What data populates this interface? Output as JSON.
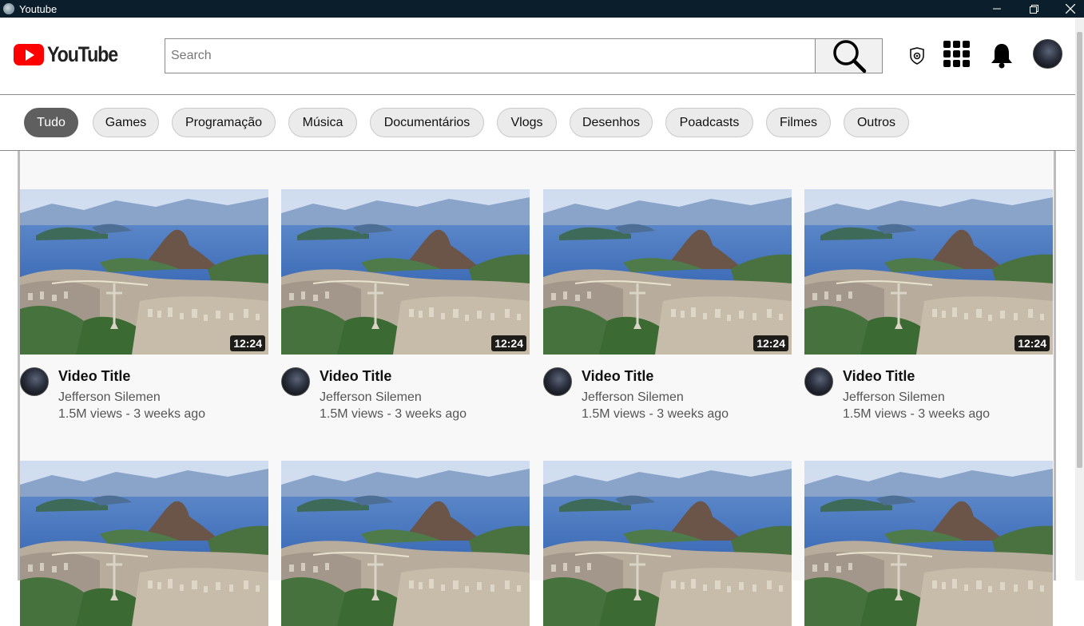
{
  "window": {
    "title": "Youtube"
  },
  "header": {
    "logo_text": "YouTube",
    "search": {
      "placeholder": "Search",
      "value": ""
    },
    "icons": [
      "search-icon",
      "camera-shield-icon",
      "apps-grid-icon",
      "bell-icon"
    ]
  },
  "chips": [
    {
      "label": "Tudo",
      "active": true
    },
    {
      "label": "Games",
      "active": false
    },
    {
      "label": "Programação",
      "active": false
    },
    {
      "label": "Música",
      "active": false
    },
    {
      "label": "Documentários",
      "active": false
    },
    {
      "label": "Vlogs",
      "active": false
    },
    {
      "label": "Desenhos",
      "active": false
    },
    {
      "label": "Poadcasts",
      "active": false
    },
    {
      "label": "Filmes",
      "active": false
    },
    {
      "label": "Outros",
      "active": false
    }
  ],
  "videos": [
    {
      "title": "Video Title",
      "channel": "Jefferson Silemen",
      "meta": "1.5M views - 3 weeks ago",
      "duration": "12:24"
    },
    {
      "title": "Video Title",
      "channel": "Jefferson Silemen",
      "meta": "1.5M views - 3 weeks ago",
      "duration": "12:24"
    },
    {
      "title": "Video Title",
      "channel": "Jefferson Silemen",
      "meta": "1.5M views - 3 weeks ago",
      "duration": "12:24"
    },
    {
      "title": "Video Title",
      "channel": "Jefferson Silemen",
      "meta": "1.5M views - 3 weeks ago",
      "duration": "12:24"
    },
    {
      "title": "",
      "channel": "",
      "meta": "",
      "duration": ""
    },
    {
      "title": "",
      "channel": "",
      "meta": "",
      "duration": ""
    },
    {
      "title": "",
      "channel": "",
      "meta": "",
      "duration": ""
    },
    {
      "title": "",
      "channel": "",
      "meta": "",
      "duration": ""
    }
  ],
  "colors": {
    "brand_red": "#ff0000",
    "chip_active": "#5f5f5f",
    "chip_idle": "#ebebeb",
    "titlebar": "#0b1e2b"
  }
}
